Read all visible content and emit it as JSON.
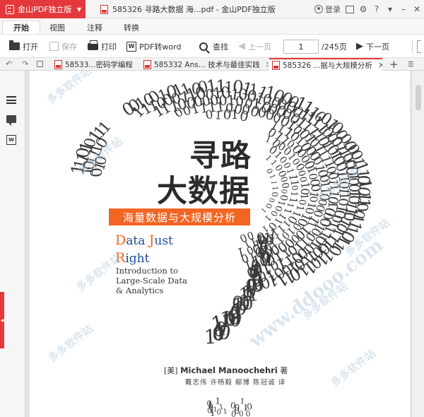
{
  "app": {
    "brand": "金山PDF独立版",
    "window_title": "585326 寻路大数据 海...pdf - 金山PDF独立版",
    "login_label": "登录"
  },
  "menu_tabs": [
    {
      "label": "开始",
      "active": true
    },
    {
      "label": "视图",
      "active": false
    },
    {
      "label": "注释",
      "active": false
    },
    {
      "label": "转换",
      "active": false
    }
  ],
  "toolbar": {
    "open": "打开",
    "save": "保存",
    "print": "打印",
    "pdf_to_word": "PDF转word",
    "find": "查找",
    "prev_page": "上一页",
    "page_value": "1",
    "page_total": "/245页",
    "next_page": "下一页"
  },
  "doc_tabs": [
    {
      "label": "58533...密码学编程",
      "active": false
    },
    {
      "label": "585332 Ans... 技术与最佳实践",
      "active": false
    },
    {
      "label": "585326 ...据与大规模分析",
      "active": true
    }
  ],
  "cover": {
    "title_line1": "寻路",
    "title_line2": "大数据",
    "subtitle_cn": "海量数据与大规模分析",
    "en_line1_cap": "D",
    "en_line1_rest": "ata ",
    "en_line1_cap2": "J",
    "en_line1_rest2": "ust",
    "en_line2_cap": "R",
    "en_line2_rest": "ight",
    "en_sub1": "Introduction to",
    "en_sub2": "Large-Scale Data",
    "en_sub3": "& Analytics",
    "author_prefix": "[美]",
    "author_name": "Michael Manoochehri",
    "author_suffix": "著",
    "translators": "戴志伟 许杨毅 郗博 陈冠诚 译"
  },
  "watermarks": {
    "site_cn": "多多软件站",
    "site_url": "www.ddooo.com"
  },
  "colors": {
    "brand_red": "#e4393c",
    "cover_orange": "#f26522",
    "cover_blue": "#1a4d9c"
  }
}
